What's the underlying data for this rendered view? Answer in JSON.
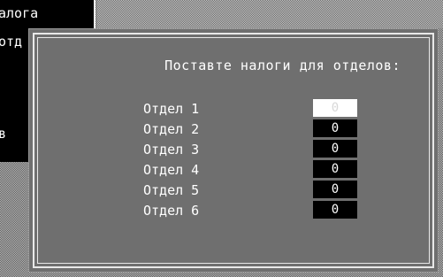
{
  "background_window": {
    "lines": [
      "алога",
      "отд",
      "в"
    ]
  },
  "dialog": {
    "title": "Поставте налоги для отделов:",
    "departments": [
      {
        "label": "Отдел 1",
        "value": "0",
        "active": true
      },
      {
        "label": "Отдел 2",
        "value": "0",
        "active": false
      },
      {
        "label": "Отдел 3",
        "value": "0",
        "active": false
      },
      {
        "label": "Отдел 4",
        "value": "0",
        "active": false
      },
      {
        "label": "Отдел 5",
        "value": "0",
        "active": false
      },
      {
        "label": "Отдел 6",
        "value": "0",
        "active": false
      }
    ]
  },
  "colors": {
    "dialog_bg": "#6f6f6f",
    "frame": "#e8e8e8",
    "field_bg": "#000000",
    "active_field_bg": "#ffffff"
  }
}
